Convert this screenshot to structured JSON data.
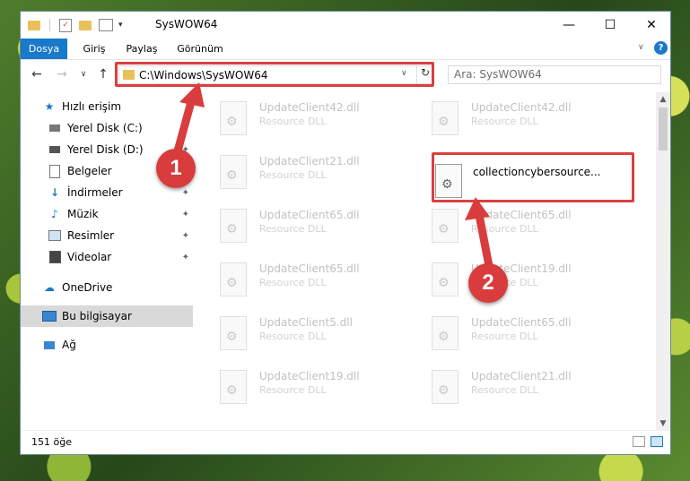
{
  "window": {
    "title": "SysWOW64"
  },
  "ribbon": {
    "tabs": [
      "Dosya",
      "Giriş",
      "Paylaş",
      "Görünüm"
    ]
  },
  "address": {
    "path": "C:\\Windows\\SysWOW64",
    "search_placeholder": "Ara: SysWOW64"
  },
  "sidebar": {
    "items": [
      {
        "label": "Hızlı erişim",
        "icon": "star-icon"
      },
      {
        "label": "Yerel Disk (C:)",
        "icon": "drive-icon"
      },
      {
        "label": "Yerel Disk (D:)",
        "icon": "drive-icon"
      },
      {
        "label": "Belgeler",
        "icon": "documents-icon"
      },
      {
        "label": "İndirmeler",
        "icon": "download-icon"
      },
      {
        "label": "Müzik",
        "icon": "music-icon"
      },
      {
        "label": "Resimler",
        "icon": "pictures-icon"
      },
      {
        "label": "Videolar",
        "icon": "video-icon"
      },
      {
        "label": "OneDrive",
        "icon": "cloud-icon"
      },
      {
        "label": "Bu bilgisayar",
        "icon": "computer-icon"
      },
      {
        "label": "Ağ",
        "icon": "network-icon"
      }
    ]
  },
  "files": [
    {
      "name": "UpdateClient42.dll",
      "type": "Resource DLL"
    },
    {
      "name": "UpdateClient42.dll",
      "type": "Resource DLL"
    },
    {
      "name": "UpdateClient21.dll",
      "type": "Resource DLL"
    },
    {
      "name": "collectioncybersource...",
      "type": ""
    },
    {
      "name": "UpdateClient65.dll",
      "type": "Resource DLL"
    },
    {
      "name": "UpdateClient65.dll",
      "type": "Resource DLL"
    },
    {
      "name": "UpdateClient65.dll",
      "type": "Resource DLL"
    },
    {
      "name": "UpdateClient19.dll",
      "type": "Resource DLL"
    },
    {
      "name": "UpdateClient5.dll",
      "type": "Resource DLL"
    },
    {
      "name": "UpdateClient65.dll",
      "type": "Resource DLL"
    },
    {
      "name": "UpdateClient19.dll",
      "type": "Resource DLL"
    },
    {
      "name": "UpdateClient21.dll",
      "type": "Resource DLL"
    }
  ],
  "status": {
    "count": "151 öğe"
  },
  "callouts": {
    "one": "1",
    "two": "2"
  },
  "colors": {
    "accent": "#1979ca",
    "highlight": "#d94040"
  }
}
